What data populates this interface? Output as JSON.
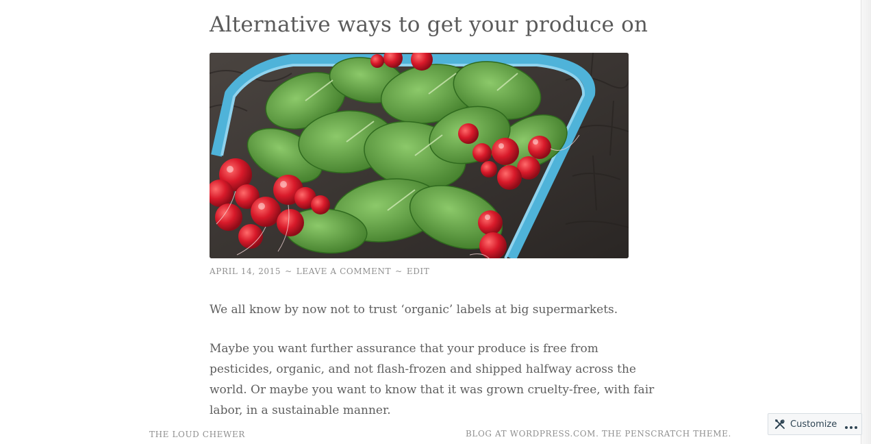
{
  "post": {
    "title": "Alternative ways to get your produce on",
    "meta": {
      "date": "APRIL 14, 2015",
      "separator": "~",
      "comment_link": "LEAVE A COMMENT",
      "edit_link": "EDIT"
    },
    "paragraphs": [
      "We all know by now not to trust ‘organic’ labels at big supermarkets.",
      "Maybe you want further assurance that your produce is free from pesticides, organic, and not flash-frozen and shipped halfway across the world. Or maybe you want to know that it was grown cruelty-free, with fair labor, in a sustainable manner."
    ]
  },
  "footer": {
    "site_name": "THE LOUD CHEWER",
    "credits": "BLOG AT WORDPRESS.COM. THE PENSCRATCH THEME."
  },
  "customize": {
    "label": "Customize",
    "icon": "tools-icon",
    "more_icon": "more-dots-icon"
  },
  "colors": {
    "text": "#5e5e5e",
    "meta": "#8f8f8f",
    "crate": "#4fb3d9",
    "radish": "#d81a2a",
    "leaf": "#5a9a3a"
  }
}
